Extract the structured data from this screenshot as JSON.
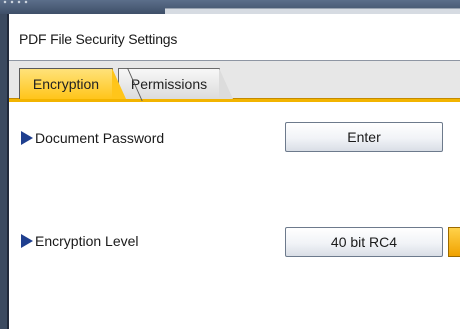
{
  "window": {
    "title": "PDF File Security Settings"
  },
  "tabs": [
    {
      "label": "Encryption",
      "active": true
    },
    {
      "label": "Permissions",
      "active": false
    }
  ],
  "settings": {
    "document_password": {
      "label": "Document Password",
      "button_label": "Enter"
    },
    "encryption_level": {
      "label": "Encryption Level",
      "value": "40 bit RC4"
    }
  },
  "colors": {
    "accent": "#f2b400",
    "active_tab": "#ffc51a",
    "arrow": "#1f3f8f",
    "frame": "#3b4a60"
  },
  "icons": {
    "row_marker": "right-triangle-icon",
    "dropdown": "dropdown-arrow-icon"
  }
}
